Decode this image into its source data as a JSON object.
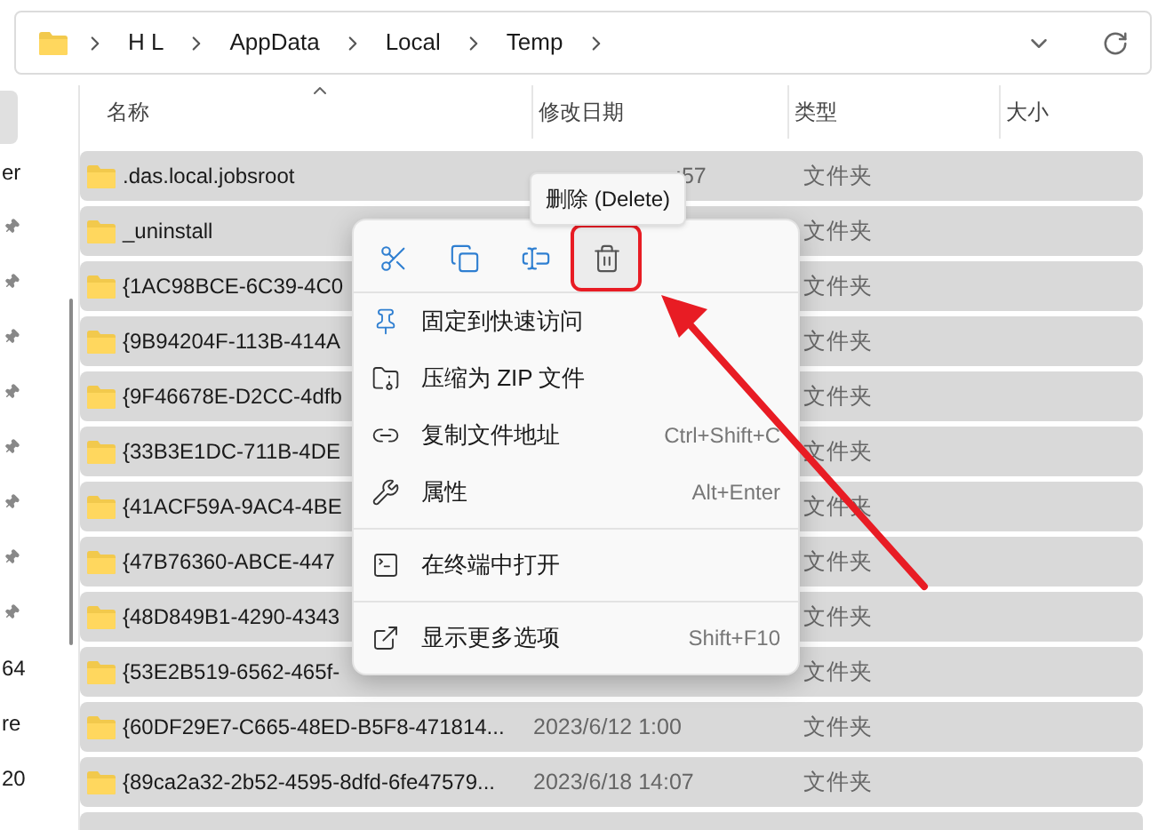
{
  "address_bar": {
    "crumbs": [
      "H L",
      "AppData",
      "Local",
      "Temp"
    ]
  },
  "sidebar": {
    "items": [
      {
        "kind": "blank",
        "selected": true
      },
      {
        "kind": "text",
        "label": "er",
        "selected": false
      },
      {
        "kind": "pin",
        "selected": false
      },
      {
        "kind": "pin",
        "selected": false
      },
      {
        "kind": "pin",
        "selected": false
      },
      {
        "kind": "pin",
        "selected": false
      },
      {
        "kind": "pin",
        "selected": false
      },
      {
        "kind": "pin",
        "selected": false
      },
      {
        "kind": "pin",
        "selected": false
      },
      {
        "kind": "pin",
        "selected": false
      },
      {
        "kind": "text",
        "label": "64",
        "selected": false
      },
      {
        "kind": "text",
        "label": "re",
        "selected": false
      },
      {
        "kind": "text",
        "label": "20",
        "selected": false
      }
    ]
  },
  "columns": [
    {
      "label": "名称",
      "sorted": true
    },
    {
      "label": "修改日期",
      "sorted": false
    },
    {
      "label": "类型",
      "sorted": false
    },
    {
      "label": "大小",
      "sorted": false
    }
  ],
  "rows": [
    {
      "name": ".das.local.jobsroot",
      "date": ":57",
      "type": "文件夹",
      "selected": true
    },
    {
      "name": "_uninstall",
      "type": "文件夹",
      "selected": true
    },
    {
      "name": "{1AC98BCE-6C39-4C0",
      "type": "文件夹",
      "selected": true
    },
    {
      "name": "{9B94204F-113B-414A",
      "type": "文件夹",
      "selected": true
    },
    {
      "name": "{9F46678E-D2CC-4dfb",
      "type": "文件夹",
      "selected": true
    },
    {
      "name": "{33B3E1DC-711B-4DE",
      "type": "文件夹",
      "selected": true
    },
    {
      "name": "{41ACF59A-9AC4-4BE",
      "type": "文件夹",
      "selected": true
    },
    {
      "name": "{47B76360-ABCE-447",
      "type": "文件夹",
      "selected": true
    },
    {
      "name": "{48D849B1-4290-4343",
      "type": "文件夹",
      "selected": true
    },
    {
      "name": "{53E2B519-6562-465f-",
      "type": "文件夹",
      "selected": true
    },
    {
      "name": "{60DF29E7-C665-48ED-B5F8-471814...",
      "date": "2023/6/12 1:00",
      "type": "文件夹",
      "selected": true
    },
    {
      "name": "{89ca2a32-2b52-4595-8dfd-6fe47579...",
      "date": "2023/6/18 14:07",
      "type": "文件夹",
      "selected": true
    },
    {
      "kind": "partial",
      "selected": true
    }
  ],
  "context_menu": {
    "tooltip": "删除 (Delete)",
    "quick_actions": [
      {
        "kind": "cut",
        "annotated": false
      },
      {
        "kind": "copy",
        "annotated": false
      },
      {
        "kind": "rename",
        "annotated": false
      },
      {
        "kind": "delete",
        "annotated": true
      }
    ],
    "items": [
      {
        "kind": "pin",
        "label": "固定到快速访问"
      },
      {
        "kind": "zip",
        "label": "压缩为 ZIP 文件"
      },
      {
        "kind": "path",
        "label": "复制文件地址",
        "shortcut": "Ctrl+Shift+C"
      },
      {
        "kind": "properties",
        "label": "属性",
        "shortcut": "Alt+Enter"
      },
      {
        "kind": "divider"
      },
      {
        "kind": "terminal",
        "label": "在终端中打开"
      },
      {
        "kind": "divider"
      },
      {
        "kind": "more",
        "label": "显示更多选项",
        "shortcut": "Shift+F10"
      }
    ]
  }
}
